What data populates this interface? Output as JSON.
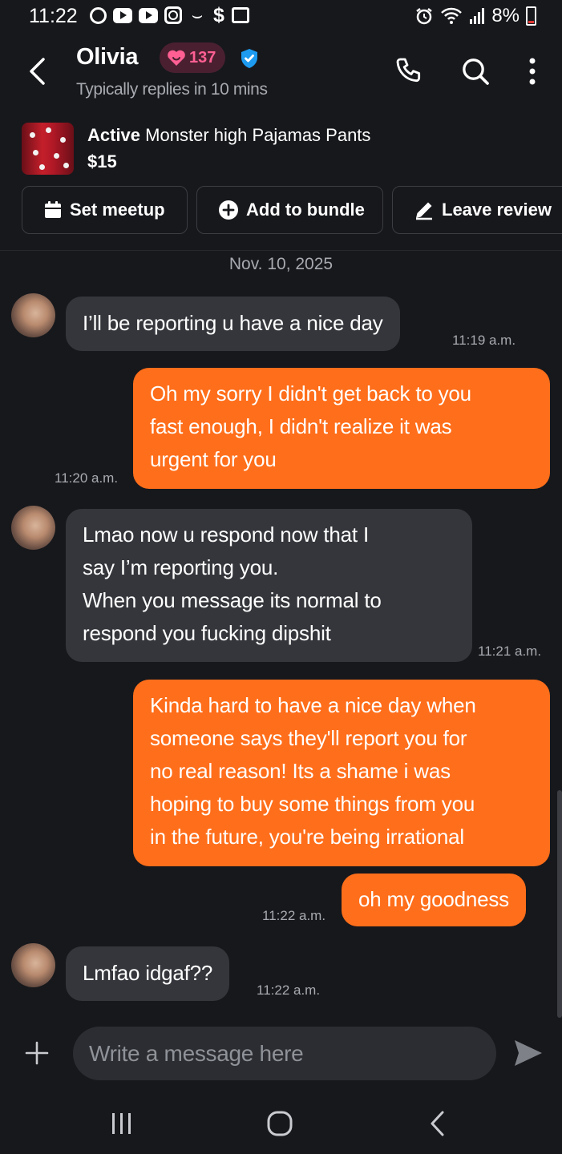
{
  "status_bar": {
    "time": "11:22",
    "battery": "8%",
    "icons": [
      "threads-icon",
      "youtube-icon",
      "youtube-icon",
      "instagram-icon",
      "wave-icon",
      "dollar-icon",
      "image-icon",
      "alarm-icon",
      "wifi-icon",
      "signal-icon",
      "battery-icon"
    ]
  },
  "header": {
    "name": "Olivia",
    "badge_count": "137",
    "subtitle": "Typically replies in 10 mins"
  },
  "listing": {
    "status": "Active",
    "title": "Monster high Pajamas Pants",
    "price": "$15"
  },
  "actions": {
    "meetup": "Set meetup",
    "bundle": "Add to bundle",
    "review": "Leave review"
  },
  "chat": {
    "date": "Nov. 10, 2025",
    "messages": [
      {
        "from": "them",
        "lines": [
          "I’ll be reporting u have a nice day"
        ],
        "time": "11:19 a.m."
      },
      {
        "from": "me",
        "lines": [
          "Oh my sorry I didn't get back to you",
          "fast enough, I didn't realize it was",
          "urgent for you"
        ],
        "time": "11:20 a.m."
      },
      {
        "from": "them",
        "lines": [
          "Lmao now u respond now that I",
          "say I’m reporting you.",
          "When you message its normal to",
          "respond you fucking dipshit"
        ],
        "time": "11:21 a.m."
      },
      {
        "from": "me",
        "lines": [
          "Kinda hard to have a nice day when",
          "someone says they'll report you for",
          "no real reason! Its a shame i was",
          "hoping to buy some things from you",
          "in the future, you're being irrational"
        ],
        "time": ""
      },
      {
        "from": "me",
        "lines": [
          "oh my goodness"
        ],
        "time": "11:22 a.m."
      },
      {
        "from": "them",
        "lines": [
          "Lmfao idgaf??"
        ],
        "time": "11:22 a.m."
      }
    ]
  },
  "composer": {
    "placeholder": "Write a message here"
  },
  "colors": {
    "background": "#17181c",
    "incoming_bubble": "#34363b",
    "outgoing_bubble": "#ff6e1a",
    "badge_text": "#ff5f93",
    "verified": "#1d9bf0"
  }
}
